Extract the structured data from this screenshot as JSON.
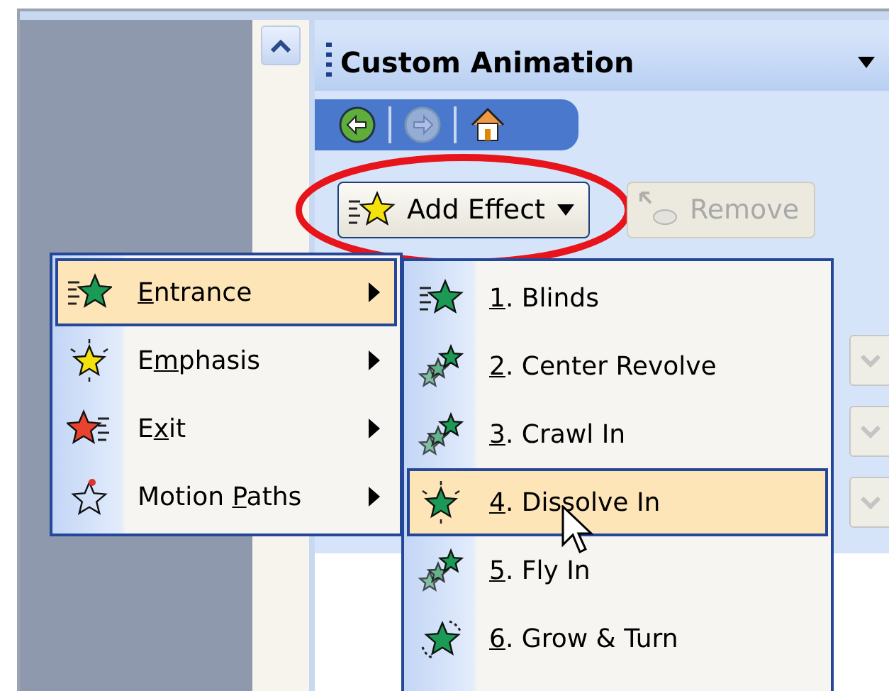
{
  "pane": {
    "title": "Custom Animation"
  },
  "nav": [
    {
      "kind": "back",
      "disabled": false
    },
    {
      "kind": "forward",
      "disabled": true
    },
    {
      "kind": "home",
      "disabled": false
    }
  ],
  "buttons": [
    {
      "kind": "add",
      "label": "Add Effect",
      "disabled": false,
      "circled": true
    },
    {
      "kind": "remove",
      "label": "Remove",
      "disabled": true,
      "circled": false
    }
  ],
  "menu": {
    "items": [
      {
        "kind": "entrance",
        "key": "E",
        "after": "ntrance",
        "submenu": true,
        "selected": true
      },
      {
        "kind": "emphasis",
        "before": "E",
        "key": "m",
        "after": "phasis",
        "submenu": true,
        "selected": false
      },
      {
        "kind": "exit",
        "before": "E",
        "key": "x",
        "after": "it",
        "submenu": true,
        "selected": false
      },
      {
        "kind": "motion",
        "before": "Motion ",
        "key": "P",
        "after": "aths",
        "submenu": true,
        "selected": false
      }
    ]
  },
  "submenu": {
    "items": [
      {
        "kind": "blinds",
        "key": "1",
        "after": ". Blinds",
        "selected": false
      },
      {
        "kind": "multi",
        "key": "2",
        "after": ". Center Revolve",
        "selected": false
      },
      {
        "kind": "multi",
        "key": "3",
        "after": ". Crawl In",
        "selected": false
      },
      {
        "kind": "burst",
        "key": "4",
        "after": ". Dissolve In",
        "selected": true
      },
      {
        "kind": "multi",
        "key": "5",
        "after": ". Fly In",
        "selected": false
      },
      {
        "kind": "turn",
        "key": "6",
        "after": ". Grow & Turn",
        "selected": false
      }
    ]
  }
}
